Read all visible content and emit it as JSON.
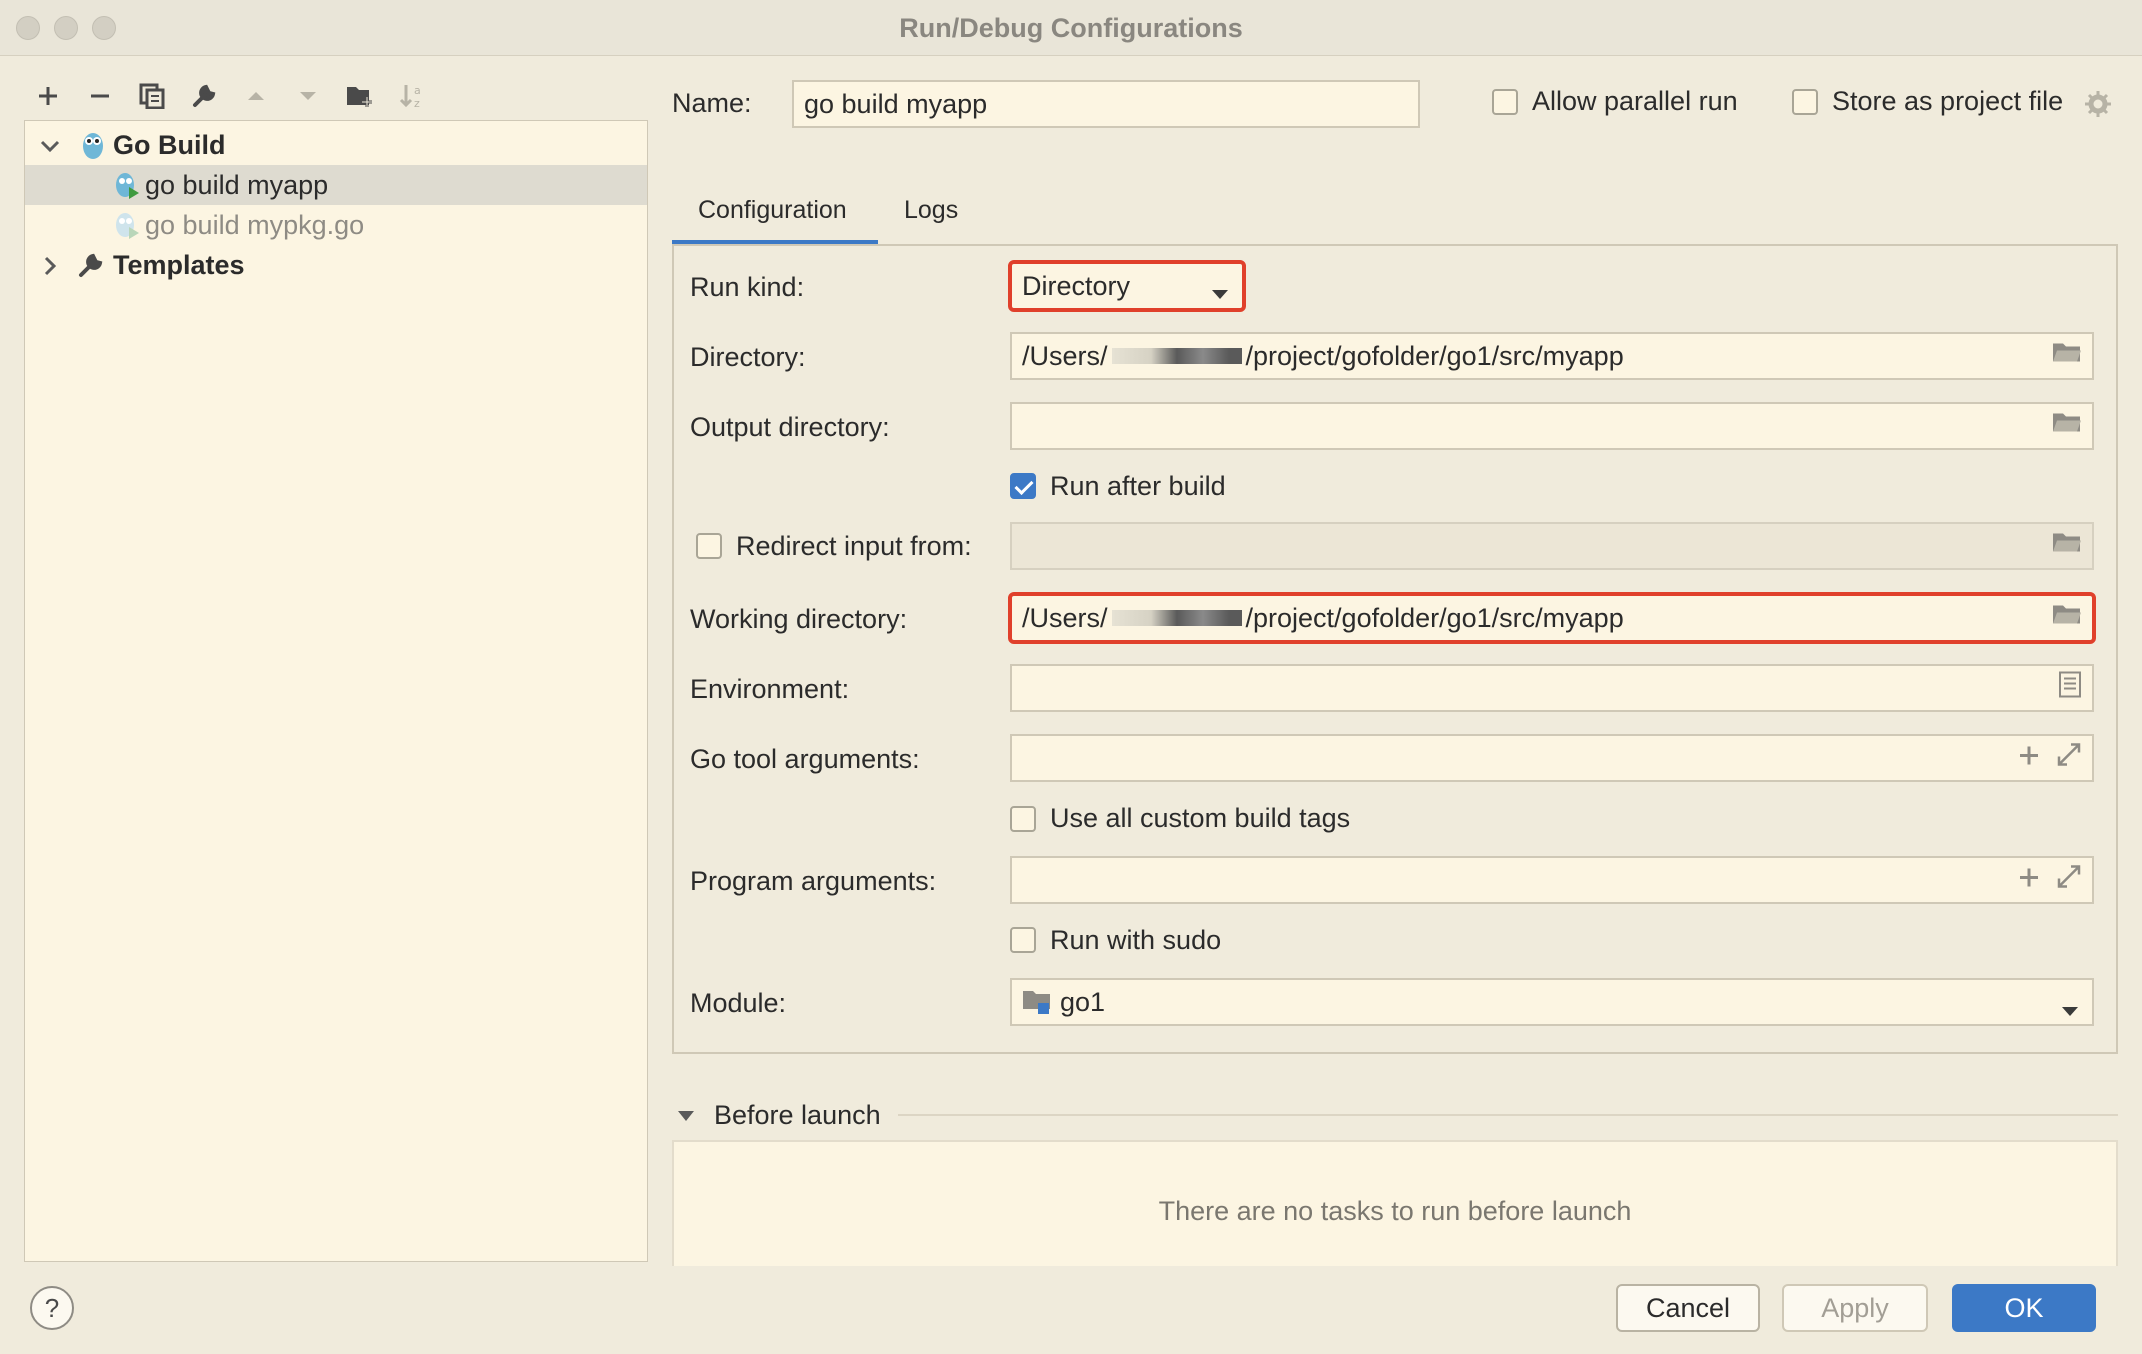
{
  "window": {
    "title": "Run/Debug Configurations"
  },
  "toolbar": {
    "icons": [
      "add-icon",
      "remove-icon",
      "copy-icon",
      "wrench-icon",
      "move-up-icon",
      "move-down-icon",
      "new-folder-icon",
      "sort-icon"
    ]
  },
  "tree": {
    "group": "Go Build",
    "items": [
      "go build myapp",
      "go build mypkg.go"
    ],
    "templates": "Templates"
  },
  "header": {
    "name_label": "Name:",
    "name_value": "go build myapp",
    "allow_parallel_label": "Allow parallel run",
    "store_project_label": "Store as project file"
  },
  "tabs": [
    "Configuration",
    "Logs"
  ],
  "config": {
    "run_kind_label": "Run kind:",
    "run_kind_value": "Directory",
    "directory_label": "Directory:",
    "directory_prefix": "/Users/",
    "directory_suffix": "/project/gofolder/go1/src/myapp",
    "output_label": "Output directory:",
    "run_after_build_label": "Run after build",
    "redirect_label": "Redirect input from:",
    "working_label": "Working directory:",
    "working_prefix": "/Users/",
    "working_suffix": "/project/gofolder/go1/src/myapp",
    "environment_label": "Environment:",
    "go_tool_label": "Go tool arguments:",
    "custom_tags_label": "Use all custom build tags",
    "program_args_label": "Program arguments:",
    "sudo_label": "Run with sudo",
    "module_label": "Module:",
    "module_value": "go1"
  },
  "before_launch": {
    "title": "Before launch",
    "empty_text": "There are no tasks to run before launch"
  },
  "buttons": {
    "help": "?",
    "cancel": "Cancel",
    "apply": "Apply",
    "ok": "OK"
  },
  "colors": {
    "accent": "#3c79c6",
    "highlight": "#e0402b",
    "background": "#f0ebdc"
  }
}
